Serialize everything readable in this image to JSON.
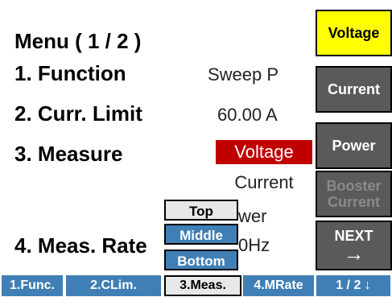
{
  "menu": {
    "title": "Menu ( 1 / 2 )"
  },
  "rows": [
    {
      "label": "1. Function",
      "value": "Sweep P"
    },
    {
      "label": "2. Curr. Limit",
      "value": "60.00 A"
    },
    {
      "label": "3. Measure",
      "options": [
        "Voltage",
        "Current",
        "Power"
      ],
      "selected": "Voltage"
    },
    {
      "label": "4. Meas. Rate",
      "value": "10Hz"
    }
  ],
  "visible_text": {
    "power_partial": "wer",
    "rate_partial": "0Hz"
  },
  "popup": {
    "items": [
      "Top",
      "Middle",
      "Bottom"
    ],
    "highlighted": "Top"
  },
  "softkeys": [
    {
      "label": "Voltage",
      "state": "selected"
    },
    {
      "label": "Current",
      "state": "normal"
    },
    {
      "label": "Power",
      "state": "normal"
    },
    {
      "line1": "Booster",
      "line2": "Current",
      "state": "disabled"
    },
    {
      "line1": "NEXT",
      "line2": "→",
      "state": "normal"
    }
  ],
  "tabs": [
    {
      "label": "1.Func.",
      "active": false
    },
    {
      "label": "2.CLim.",
      "active": false
    },
    {
      "label": "3.Meas.",
      "active": true
    },
    {
      "label": "4.MRate",
      "active": false
    },
    {
      "label": "1 / 2 ↓",
      "active": false
    }
  ],
  "colors": {
    "accent_blue": "#3f7fb5",
    "selected_yellow": "#ffff00",
    "value_red": "#c00000",
    "softkey_gray": "#5a5a5a"
  }
}
